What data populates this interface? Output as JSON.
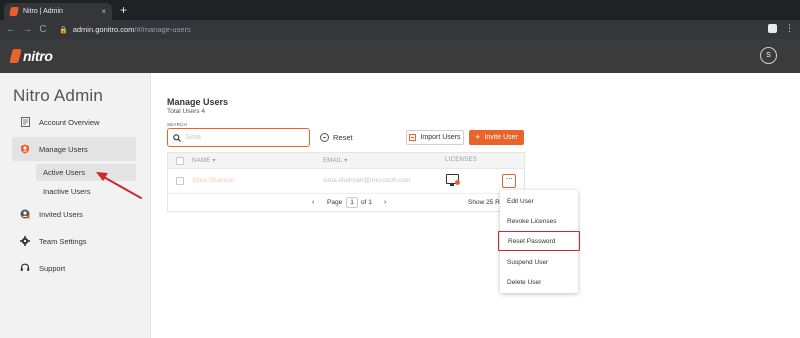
{
  "browser": {
    "tab_title": "Nitro | Admin",
    "tab_close": "×",
    "new_tab": "+",
    "nav": {
      "back": "←",
      "forward": "→",
      "reload": "C"
    },
    "url_host": "admin.gonitro.com",
    "url_path": "/#/manage-users"
  },
  "header": {
    "brand": "nitro",
    "avatar_initial": "S"
  },
  "sidebar": {
    "title": "Nitro Admin",
    "items": [
      {
        "label": "Account Overview",
        "icon": "document-icon"
      },
      {
        "label": "Manage Users",
        "icon": "users-shield-icon"
      },
      {
        "label": "Invited Users",
        "icon": "invited-user-icon"
      },
      {
        "label": "Team Settings",
        "icon": "gear-icon"
      },
      {
        "label": "Support",
        "icon": "headset-icon"
      }
    ],
    "sub_items": [
      {
        "label": "Active Users"
      },
      {
        "label": "Inactive Users"
      }
    ]
  },
  "main": {
    "title": "Manage Users",
    "subtitle": "Total Users 4",
    "search": {
      "label": "SEARCH",
      "placeholder": "Sima"
    },
    "reset_label": "Reset",
    "import_label": "Import Users",
    "invite_label": "+ Invite User",
    "invite_text": "Invite User",
    "table": {
      "columns": [
        "NAME ▾",
        "EMAIL ▾",
        "LICENSES"
      ],
      "rows": [
        {
          "name": "Sima Shahriari",
          "email": "sima.shahriari@microsoft.com"
        }
      ],
      "row_menu": "···"
    },
    "pager": {
      "prev": "‹",
      "label": "Page",
      "page": "1",
      "of": "of 1",
      "next": "›",
      "page_size": "Show 25 Ro"
    }
  },
  "dropdown": {
    "items": [
      "Edit User",
      "Revoke Licenses",
      "Reset Password",
      "Suspend User",
      "Delete User"
    ],
    "highlighted": "Reset Password"
  },
  "colors": {
    "accent": "#e8642c",
    "header_bg": "#3b3b3b",
    "highlight_box": "#d0272c",
    "annotation_arrow": "#d0272c"
  }
}
